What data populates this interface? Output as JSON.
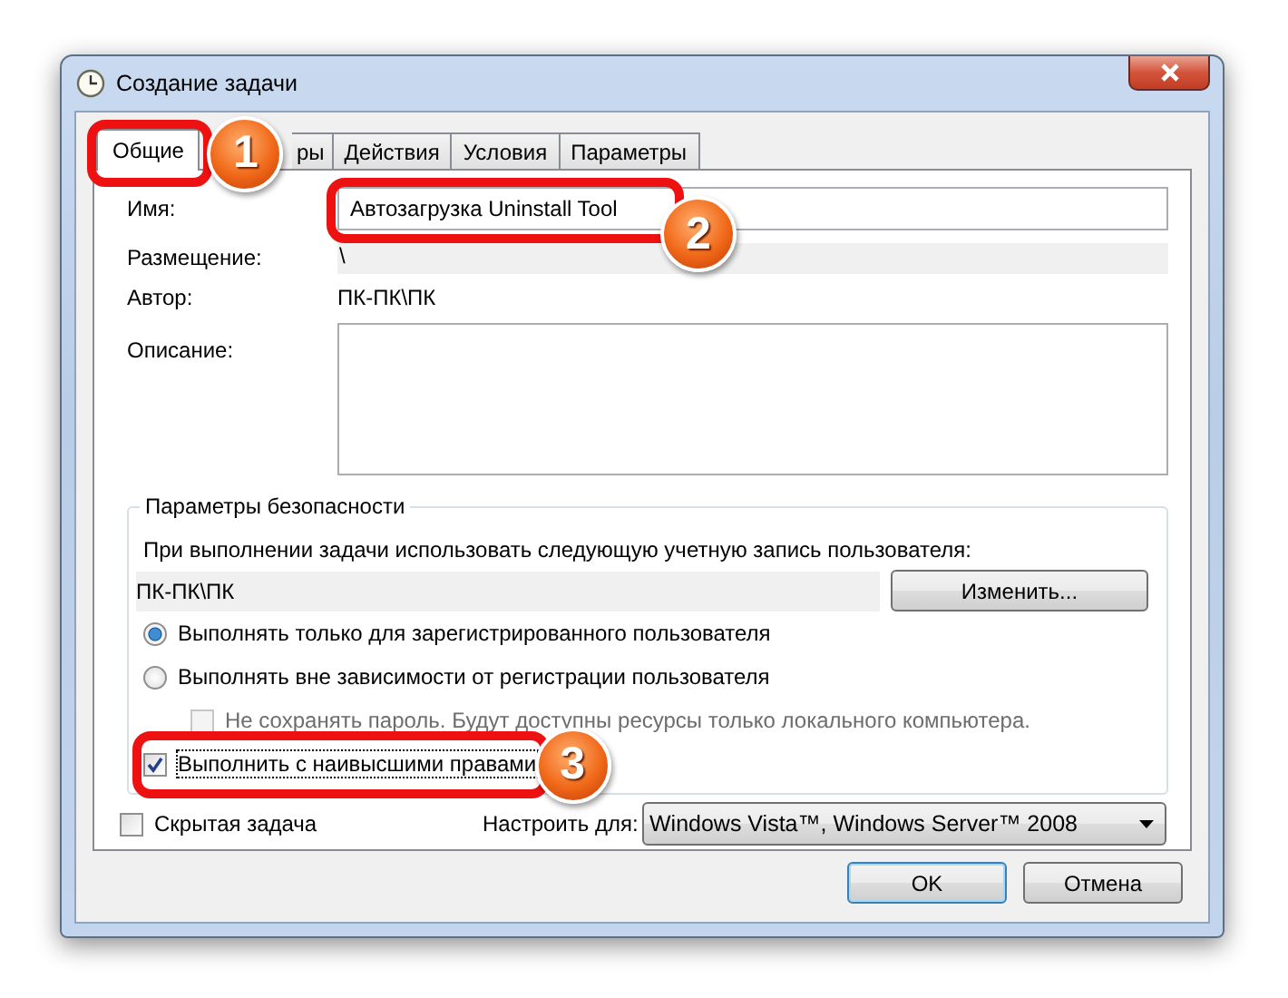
{
  "window": {
    "title": "Создание задачи"
  },
  "tabs": [
    {
      "label": "Общие",
      "selected": true
    },
    {
      "label": "ры",
      "selected": false
    },
    {
      "label": "Действия",
      "selected": false
    },
    {
      "label": "Условия",
      "selected": false
    },
    {
      "label": "Параметры",
      "selected": false
    }
  ],
  "fields": [
    {
      "kind": "input",
      "label": "Имя:",
      "value": "Автозагрузка Uninstall Tool"
    },
    {
      "kind": "readonly",
      "label": "Размещение:",
      "value": "\\"
    },
    {
      "kind": "text",
      "label": "Автор:",
      "value": "ПК-ПК\\ПК"
    },
    {
      "kind": "textarea",
      "label": "Описание:"
    }
  ],
  "security": {
    "title": "Параметры безопасности",
    "prompt": "При выполнении задачи использовать следующую учетную запись пользователя:",
    "account": "ПК-ПК\\ПК",
    "change_button": "Изменить...",
    "options": [
      {
        "kind": "radio",
        "label": "Выполнять только для зарегистрированного пользователя",
        "selected": true
      },
      {
        "kind": "radio",
        "label": "Выполнять вне зависимости от регистрации пользователя",
        "selected": false,
        "children": [
          {
            "kind": "checkbox",
            "label": "Не сохранять пароль. Будут доступны ресурсы только локального компьютера.",
            "checked": false,
            "disabled": true
          }
        ]
      },
      {
        "kind": "checkbox",
        "label": "Выполнить с наивысшими правами",
        "checked": true,
        "disabled": false
      }
    ]
  },
  "hidden_task": {
    "label": "Скрытая задача",
    "checked": false
  },
  "configure": {
    "label": "Настроить для:",
    "value": "Windows Vista™, Windows Server™ 2008"
  },
  "buttons": [
    {
      "label": "OK",
      "default": true
    },
    {
      "label": "Отмена",
      "default": false
    }
  ],
  "callouts": [
    {
      "number": "1"
    },
    {
      "number": "2"
    },
    {
      "number": "3"
    }
  ]
}
